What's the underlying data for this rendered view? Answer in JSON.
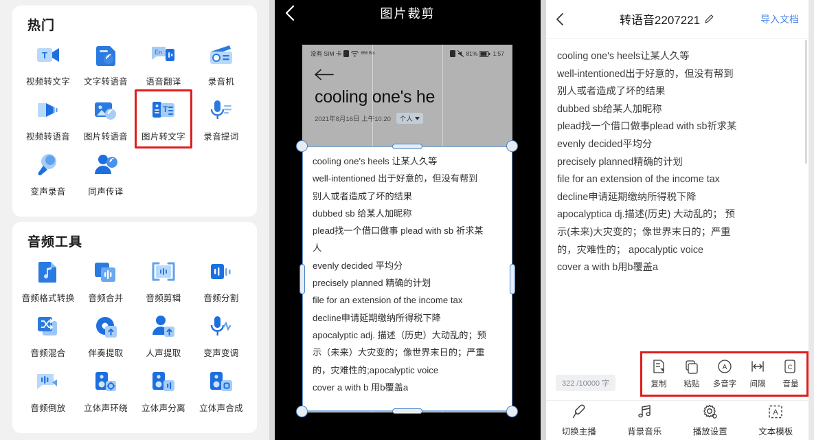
{
  "left_panel": {
    "sections": [
      {
        "title": "热门",
        "items": [
          {
            "label": "视频转文字",
            "icon": "video-to-text-icon",
            "highlighted": false
          },
          {
            "label": "文字转语音",
            "icon": "text-to-speech-icon",
            "highlighted": false
          },
          {
            "label": "语音翻译",
            "icon": "voice-translate-icon",
            "highlighted": false
          },
          {
            "label": "录音机",
            "icon": "recorder-icon",
            "highlighted": false
          },
          {
            "label": "视频转语音",
            "icon": "video-to-speech-icon",
            "highlighted": false
          },
          {
            "label": "图片转语音",
            "icon": "image-to-speech-icon",
            "highlighted": false
          },
          {
            "label": "图片转文字",
            "icon": "image-to-text-icon",
            "highlighted": true
          },
          {
            "label": "录音提词",
            "icon": "recording-prompter-icon",
            "highlighted": false
          },
          {
            "label": "变声录音",
            "icon": "voice-change-record-icon",
            "highlighted": false
          },
          {
            "label": "同声传译",
            "icon": "simultaneous-interpretation-icon",
            "highlighted": false
          }
        ]
      },
      {
        "title": "音频工具",
        "items": [
          {
            "label": "音频格式转换",
            "icon": "audio-format-convert-icon",
            "highlighted": false
          },
          {
            "label": "音频合并",
            "icon": "audio-merge-icon",
            "highlighted": false
          },
          {
            "label": "音频剪辑",
            "icon": "audio-clip-icon",
            "highlighted": false
          },
          {
            "label": "音频分割",
            "icon": "audio-split-icon",
            "highlighted": false
          },
          {
            "label": "音频混合",
            "icon": "audio-mix-icon",
            "highlighted": false
          },
          {
            "label": "伴奏提取",
            "icon": "accompaniment-extract-icon",
            "highlighted": false
          },
          {
            "label": "人声提取",
            "icon": "vocal-extract-icon",
            "highlighted": false
          },
          {
            "label": "变声变调",
            "icon": "pitch-change-icon",
            "highlighted": false
          },
          {
            "label": "音频倒放",
            "icon": "audio-reverse-icon",
            "highlighted": false
          },
          {
            "label": "立体声环绕",
            "icon": "stereo-surround-icon",
            "highlighted": false
          },
          {
            "label": "立体声分离",
            "icon": "stereo-separate-icon",
            "highlighted": false
          },
          {
            "label": "立体声合成",
            "icon": "stereo-synthesis-icon",
            "highlighted": false
          }
        ]
      }
    ]
  },
  "middle_panel": {
    "title": "图片裁剪",
    "back_icon": "chevron-left-icon",
    "photo": {
      "status_bar": {
        "carrier": "没有 SIM 卡",
        "network_speed": "856 B/s",
        "battery": "81%",
        "time": "1:57"
      },
      "note_back_icon": "arrow-left-icon",
      "note_title": "cooling one's he",
      "note_date": "2021年8月16日 上午10:20",
      "note_tag": "个人",
      "lines": [
        "cooling one's heels 让某人久等",
        "well-intentioned 出于好意的，但没有帮到",
        "别人或者造成了坏的结果",
        "dubbed sb 给某人加昵称",
        "plead找一个借口做事 plead with sb 祈求某",
        "人",
        "evenly decided 平均分",
        "precisely planned 精确的计划",
        "file for an extension of the income tax",
        "decline申请延期缴纳所得税下降",
        "apocalyptic adj. 描述（历史）大动乱的；预",
        "示（未来）大灾变的；像世界末日的；严重",
        "的，灾难性的;apocalyptic voice",
        "cover a with b 用b覆盖a"
      ]
    }
  },
  "right_panel": {
    "back_icon": "chevron-left-icon",
    "title": "转语音2207221",
    "edit_icon": "pencil-icon",
    "import_label": "导入文档",
    "content_lines": [
      "cooling one's heels让某人久等",
      "well-intentioned出于好意的，但没有帮到",
      "别人或者造成了坏的结果",
      "dubbed sb给某人加昵称",
      "plead找一个借口做事plead with sb祈求某",
      "evenly decided平均分",
      "precisely planned精确的计划",
      "file for an extension of the income tax",
      "decline申请延期缴纳所得税下降",
      "apocalyptica dj.描述(历史) 大动乱的； 预",
      "示(未来)大灾变的；像世界末日的；严重",
      "的，灾难性的； apocalyptic voice",
      "cover a with b用b覆盖a"
    ],
    "counter": "322 /10000 字",
    "format_toolbar": {
      "highlighted": true,
      "items": [
        {
          "label": "复制",
          "icon": "copy-doc-icon"
        },
        {
          "label": "粘贴",
          "icon": "paste-icon"
        },
        {
          "label": "多音字",
          "icon": "polyphone-icon"
        },
        {
          "label": "间隔",
          "icon": "spacing-icon"
        },
        {
          "label": "音量",
          "icon": "volume-icon"
        }
      ]
    },
    "tabbar": [
      {
        "label": "切换主播",
        "icon": "microphone-icon"
      },
      {
        "label": "背景音乐",
        "icon": "music-note-icon"
      },
      {
        "label": "播放设置",
        "icon": "gear-icon"
      },
      {
        "label": "文本模板",
        "icon": "text-template-icon"
      }
    ]
  },
  "colors": {
    "accent_blue": "#2b7ae0",
    "highlight_red": "#e11b1b",
    "link_blue": "#4a86e8",
    "icon_light": "#a8cdf5",
    "icon_dark": "#1d6fe0"
  }
}
